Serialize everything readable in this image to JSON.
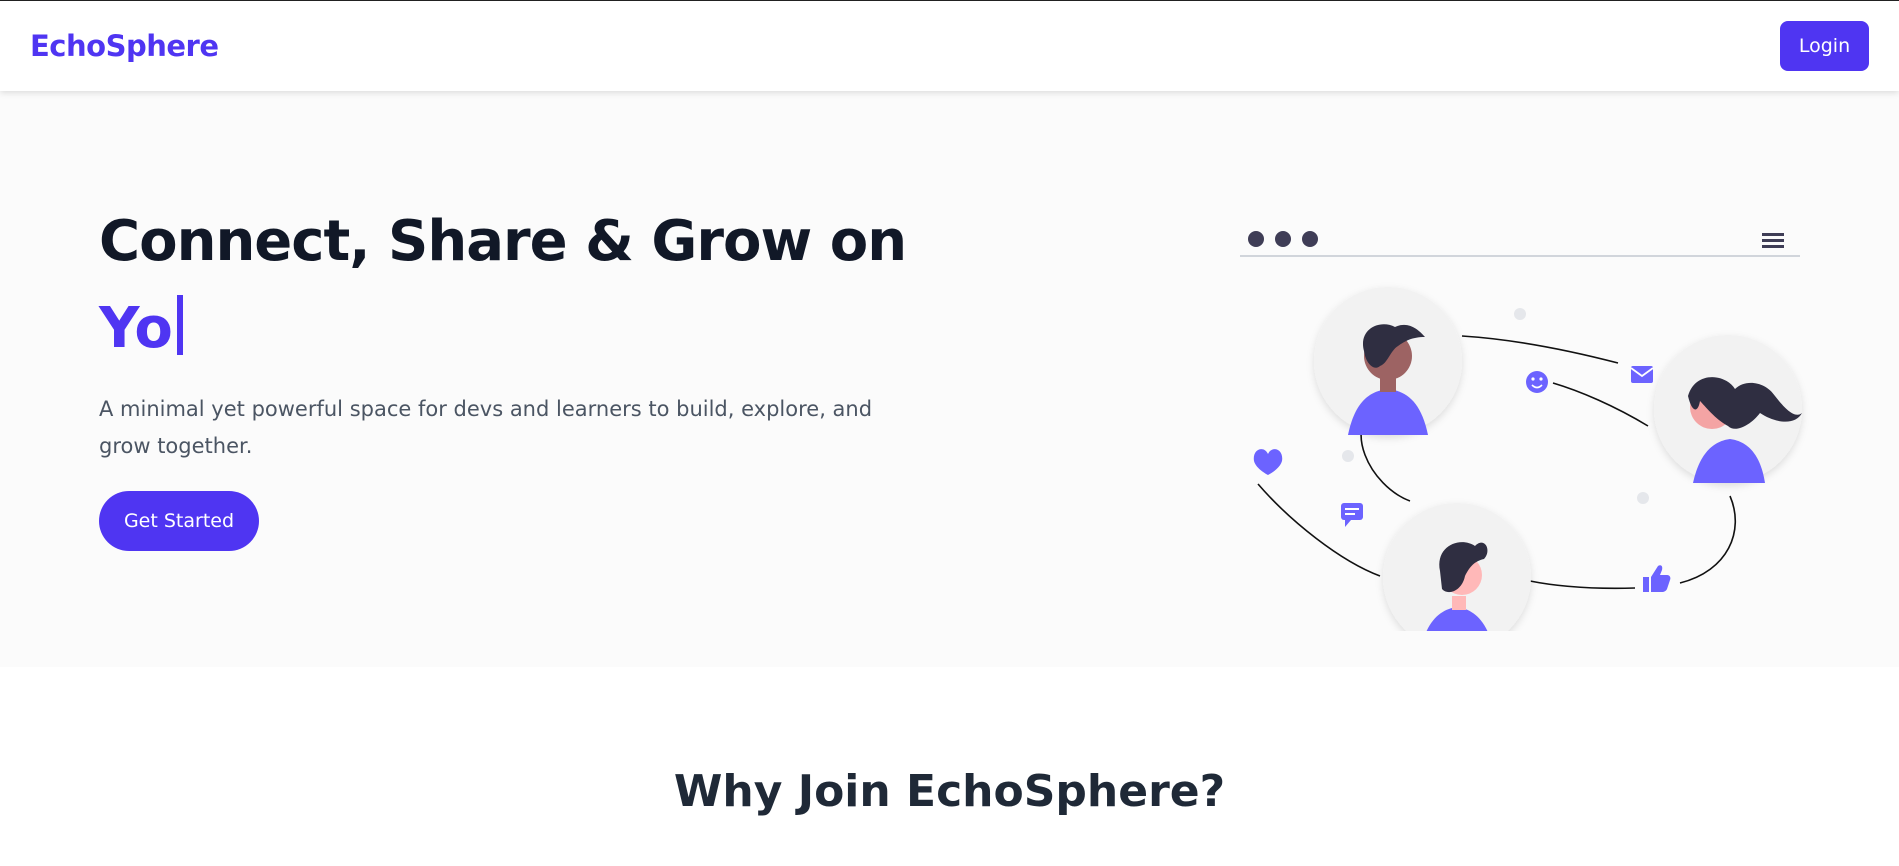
{
  "navbar": {
    "brand": "EchoSphere",
    "login_label": "Login"
  },
  "hero": {
    "headline": "Connect, Share & Grow on",
    "typed_text": "Yo",
    "subtitle": "A minimal yet powerful space for devs and learners to build, explore, and grow together.",
    "cta_label": "Get Started"
  },
  "features": {
    "title": "Why Join EchoSphere?"
  },
  "colors": {
    "accent": "#4f35f2",
    "illustration_accent": "#6c63ff",
    "heading": "#111827",
    "body_text": "#4b5563",
    "hero_background": "#fbfbfb"
  },
  "icons": [
    "hamburger-menu-icon",
    "heart-icon",
    "chat-icon",
    "mail-icon",
    "smiley-icon",
    "thumbs-up-icon"
  ]
}
